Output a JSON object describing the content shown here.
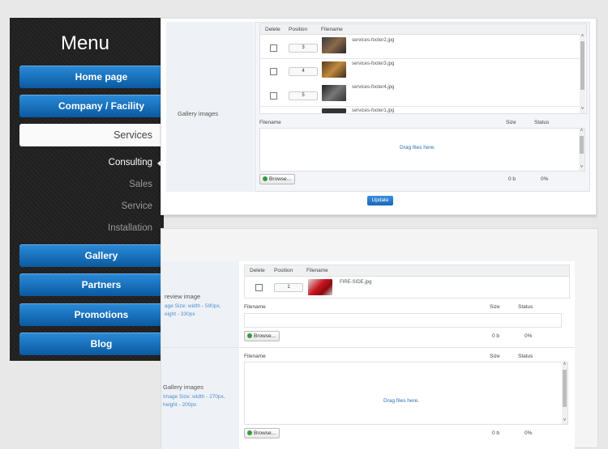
{
  "menu": {
    "title": "Menu",
    "items": [
      {
        "label": "Home page"
      },
      {
        "label": "Company / Facility"
      },
      {
        "label": "Services"
      },
      {
        "label": "Gallery"
      },
      {
        "label": "Partners"
      },
      {
        "label": "Promotions"
      },
      {
        "label": "Blog"
      }
    ],
    "subitems": [
      {
        "label": "Consulting"
      },
      {
        "label": "Sales"
      },
      {
        "label": "Service"
      },
      {
        "label": "Installation"
      }
    ]
  },
  "panel1": {
    "section_label": "Gallery images",
    "table_headers": {
      "delete": "Delete",
      "position": "Position",
      "filename": "Filename"
    },
    "rows": [
      {
        "position": "3",
        "filename": "services-footer2.jpg"
      },
      {
        "position": "4",
        "filename": "services-footer3.jpg"
      },
      {
        "position": "5",
        "filename": "services-footer4.jpg"
      },
      {
        "position": "",
        "filename": "services-footer1.jpg"
      }
    ],
    "upload_headers": {
      "filename": "Filename",
      "size": "Size",
      "status": "Status"
    },
    "drop_text": "Drag files here.",
    "browse_label": "Browse...",
    "size_value": "0 b",
    "status_value": "0%",
    "update_label": "Update"
  },
  "panel2": {
    "preview_label": "review image",
    "preview_hint_1": "age Size: width - 590px,",
    "preview_hint_2": "eight - 330px",
    "table_headers": {
      "delete": "Delete",
      "position": "Position",
      "filename": "Filename"
    },
    "rows": [
      {
        "position": "1",
        "filename": "FIRE-SIDE.jpg"
      }
    ],
    "upload_headers": {
      "filename": "Filename",
      "size": "Size",
      "status": "Status"
    },
    "browse_label": "Browse...",
    "size_value": "0 b",
    "status_value": "0%",
    "gallery_label": "Gallery images",
    "gallery_hint_1": "Image Size: width - 270px,",
    "gallery_hint_2": "height - 200px",
    "gallery_upload_headers": {
      "filename": "Filename",
      "size": "Size",
      "status": "Status"
    },
    "drop_text": "Drag files here.",
    "gallery_browse_label": "Browse...",
    "gallery_size_value": "0 b",
    "gallery_status_value": "0%"
  },
  "colors": {
    "menu_blue": "#1a74c4",
    "link_blue": "#2d6fb8",
    "update_blue": "#2a7ccc"
  }
}
